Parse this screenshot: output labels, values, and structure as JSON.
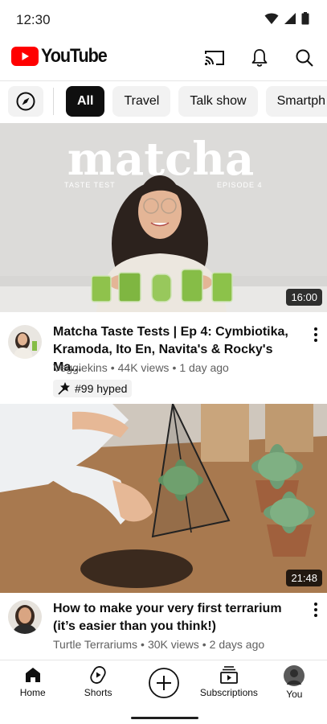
{
  "status_bar": {
    "time": "12:30"
  },
  "header": {
    "brand": "YouTube",
    "actions": [
      "cast-icon",
      "bell-icon",
      "search-icon"
    ],
    "brand_color": "#ff0000"
  },
  "chips": [
    "All",
    "Travel",
    "Talk show",
    "Smartph"
  ],
  "active_chip": "All",
  "videos": [
    {
      "thumbnail_title": "matcha",
      "thumbnail_subtitle_left": "TASTE TEST",
      "thumbnail_subtitle_right": "EPISODE 4",
      "duration": "16:00",
      "title": "Matcha Taste Tests | Ep 4: Cymbiotika, Kramoda, Ito En, Navita's & Rocky's Ma...",
      "channel": "Veggiekins",
      "views": "44K views",
      "age": "1 day ago",
      "badge": "#99 hyped"
    },
    {
      "duration": "21:48",
      "title": "How to make your very first terrarium (it’s easier than you think!)",
      "channel": "Turtle Terrariums",
      "views": "30K views",
      "age": "2 days ago"
    }
  ],
  "bottom_nav": {
    "home": "Home",
    "shorts": "Shorts",
    "subscriptions": "Subscriptions",
    "you": "You"
  }
}
